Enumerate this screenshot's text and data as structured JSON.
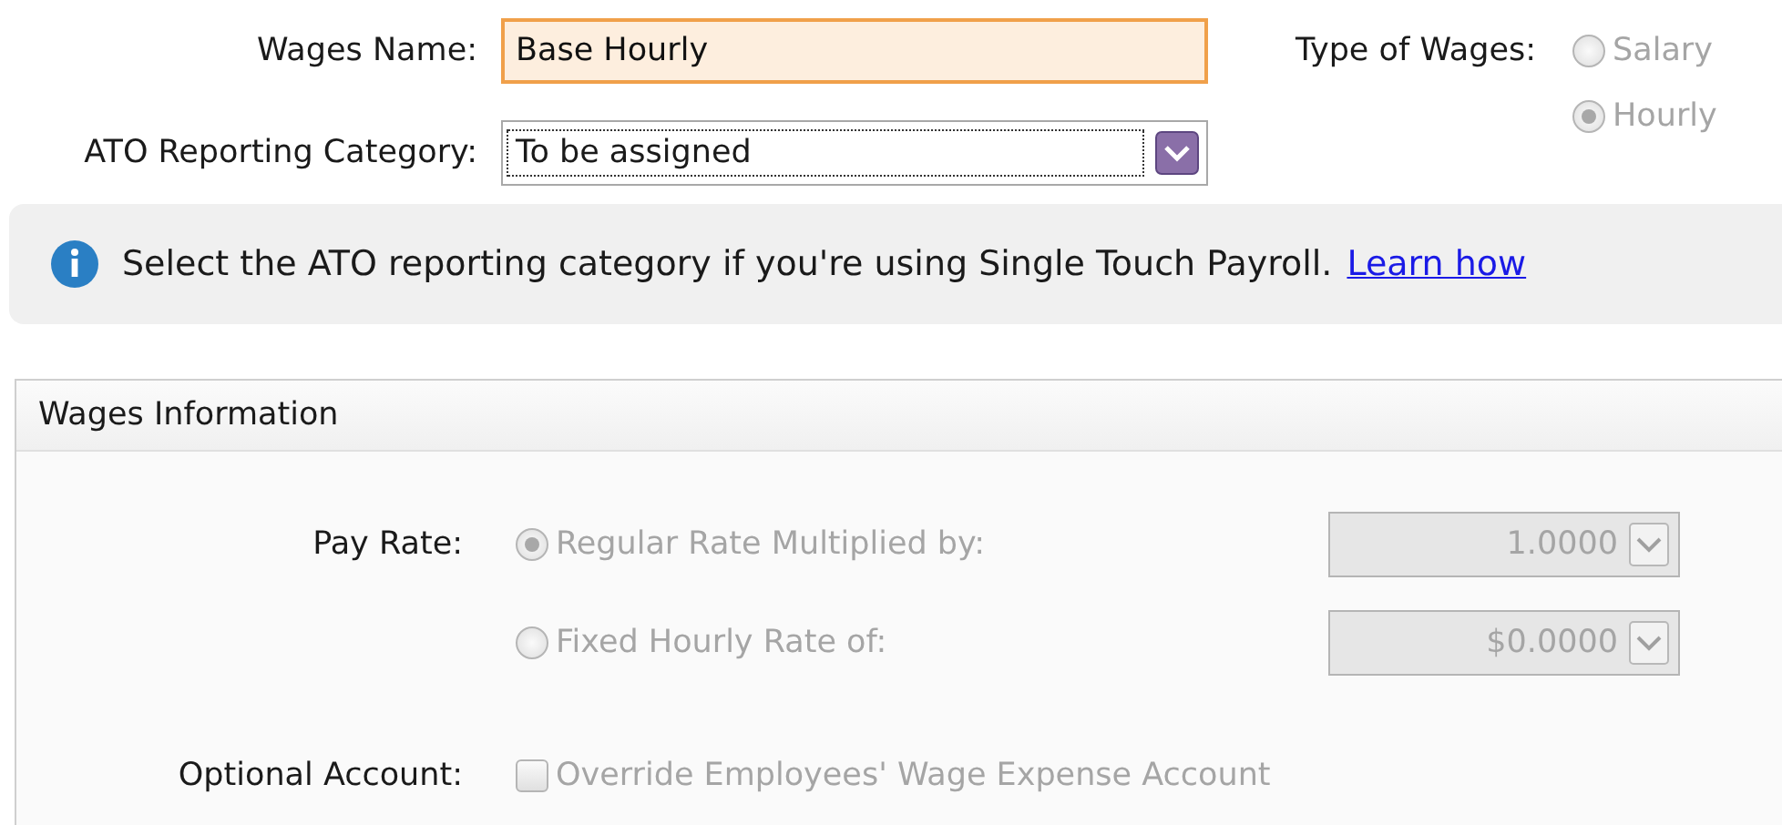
{
  "wages_name": {
    "label": "Wages Name:",
    "value": "Base Hourly"
  },
  "type_of_wages": {
    "label": "Type of Wages:",
    "options": [
      {
        "label": "Salary",
        "selected": false
      },
      {
        "label": "Hourly",
        "selected": true
      }
    ]
  },
  "ato_category": {
    "label": "ATO Reporting Category:",
    "value": "To be assigned"
  },
  "info": {
    "text": "Select the ATO reporting category if you're using Single Touch Payroll.",
    "link": "Learn how"
  },
  "panel": {
    "title": "Wages Information",
    "pay_rate": {
      "label": "Pay Rate:",
      "options": [
        {
          "label": "Regular Rate Multiplied by:",
          "selected": true,
          "value": "1.0000"
        },
        {
          "label": "Fixed Hourly Rate of:",
          "selected": false,
          "value": "$0.0000"
        }
      ]
    },
    "optional_account": {
      "label": "Optional Account:",
      "checkbox": {
        "label": "Override Employees' Wage Expense Account",
        "checked": false
      }
    }
  }
}
